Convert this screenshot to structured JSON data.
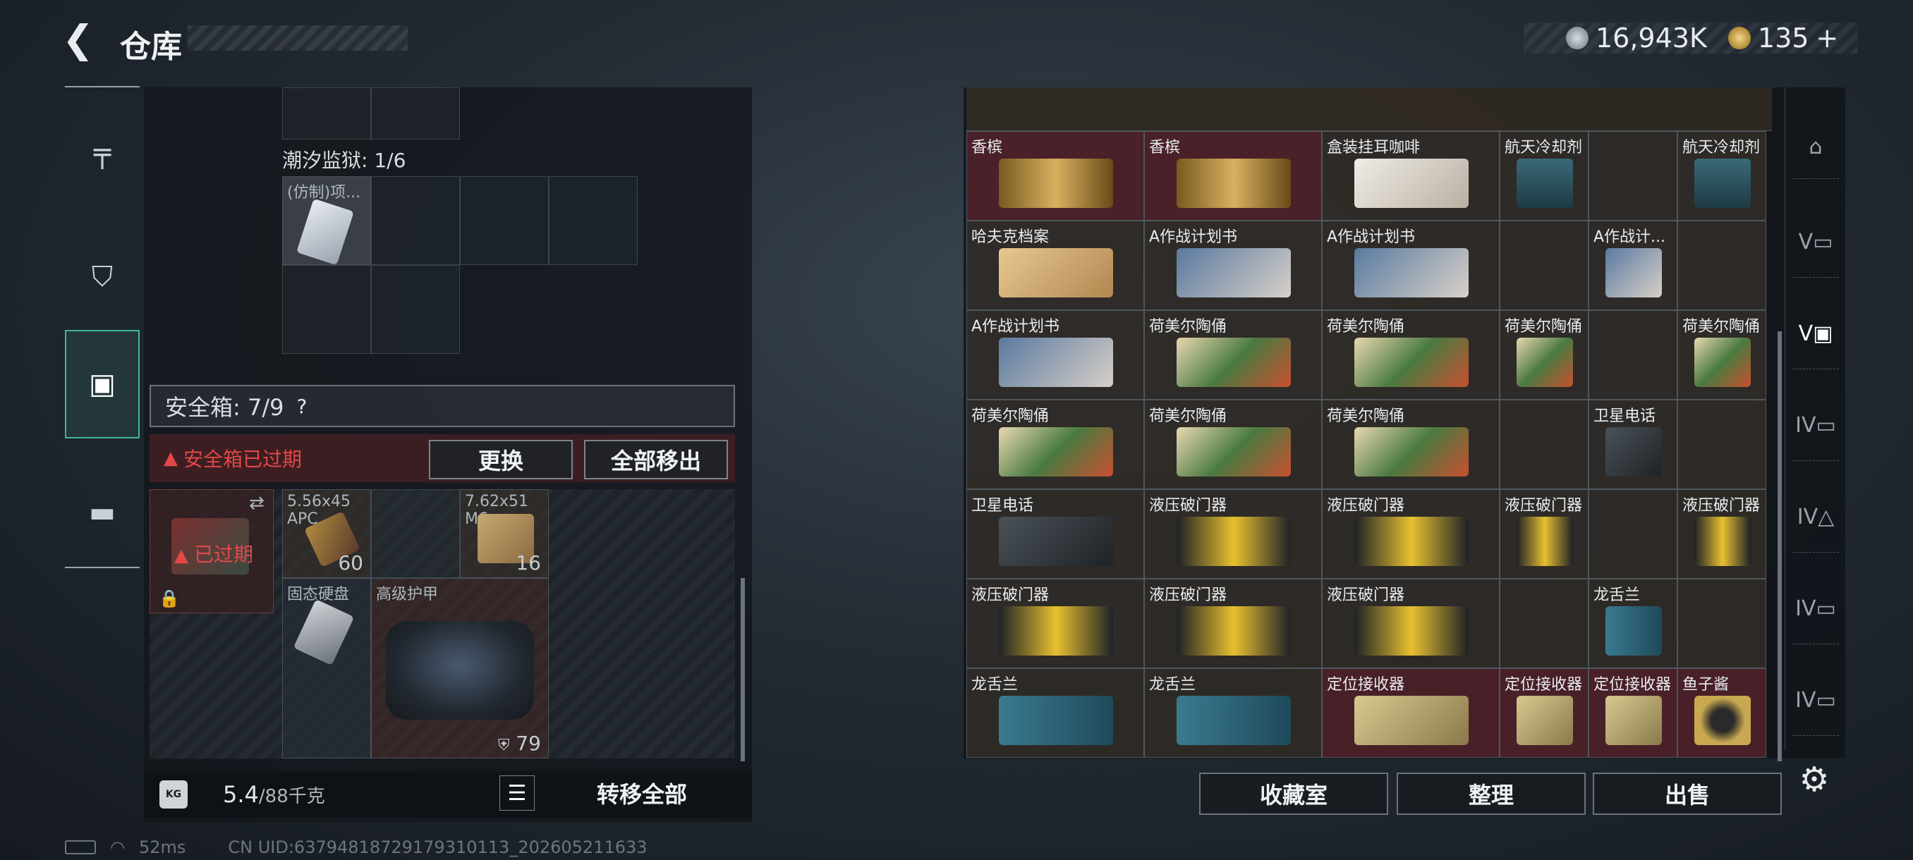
{
  "header": {
    "back_icon": "back-arrow-icon",
    "title": "仓库",
    "currency_1": "16,943K",
    "currency_2": "135",
    "currency_plus": "+"
  },
  "left_nav": [
    {
      "icon": "gun-icon",
      "glyph": "⌐"
    },
    {
      "icon": "backpack-icon",
      "glyph": "⛉"
    },
    {
      "icon": "safebox-icon",
      "glyph": "▣"
    },
    {
      "icon": "briefcase-icon",
      "glyph": "💼"
    }
  ],
  "container": {
    "label": "潮汐监狱: 1/6",
    "item_label": "(仿制)项..."
  },
  "safebox": {
    "title": "安全箱: 7/9",
    "help": "?",
    "expired_message": "安全箱已过期",
    "swap_label": "更换",
    "remove_all_label": "全部移出",
    "thumb_status": "已过期",
    "items": [
      {
        "label": "5.56x45 APC",
        "count": "60"
      },
      {
        "label": "7.62x51 M6",
        "count": "16"
      },
      {
        "label": "固态硬盘",
        "count": ""
      },
      {
        "label": "高级护甲",
        "count": "79"
      }
    ]
  },
  "bottom_left": {
    "weight_icon": "KG",
    "weight": "5.4",
    "weight_max": "/88千克",
    "transfer_all": "转移全部"
  },
  "stash": {
    "rows": [
      [
        {
          "label": "香槟",
          "tone": "red"
        },
        {
          "label": "香槟",
          "tone": "red"
        },
        {
          "label": "盒装挂耳咖啡",
          "tone": "normal"
        },
        {
          "label": "航天冷却剂",
          "tone": "normal"
        },
        {
          "label": "",
          "tone": "normal"
        },
        {
          "label": "航天冷却剂",
          "tone": "normal"
        }
      ],
      [
        {
          "label": "哈夫克档案",
          "tone": "normal"
        },
        {
          "label": "A作战计划书",
          "tone": "normal"
        },
        {
          "label": "A作战计划书",
          "tone": "normal"
        },
        {
          "label": "",
          "tone": "normal"
        },
        {
          "label": "A作战计...",
          "tone": "normal"
        },
        {
          "label": "",
          "tone": "normal"
        }
      ],
      [
        {
          "label": "A作战计划书",
          "tone": "normal"
        },
        {
          "label": "荷美尔陶俑",
          "tone": "normal"
        },
        {
          "label": "荷美尔陶俑",
          "tone": "normal"
        },
        {
          "label": "荷美尔陶俑",
          "tone": "normal"
        },
        {
          "label": "",
          "tone": "normal"
        },
        {
          "label": "荷美尔陶俑",
          "tone": "normal"
        }
      ],
      [
        {
          "label": "荷美尔陶俑",
          "tone": "normal"
        },
        {
          "label": "荷美尔陶俑",
          "tone": "normal"
        },
        {
          "label": "荷美尔陶俑",
          "tone": "normal"
        },
        {
          "label": "",
          "tone": "normal"
        },
        {
          "label": "卫星电话",
          "tone": "normal"
        },
        {
          "label": "",
          "tone": "normal"
        }
      ],
      [
        {
          "label": "卫星电话",
          "tone": "normal"
        },
        {
          "label": "液压破门器",
          "tone": "normal"
        },
        {
          "label": "液压破门器",
          "tone": "normal"
        },
        {
          "label": "液压破门器",
          "tone": "normal"
        },
        {
          "label": "",
          "tone": "normal"
        },
        {
          "label": "液压破门器",
          "tone": "normal"
        }
      ],
      [
        {
          "label": "液压破门器",
          "tone": "normal"
        },
        {
          "label": "液压破门器",
          "tone": "normal"
        },
        {
          "label": "液压破门器",
          "tone": "normal"
        },
        {
          "label": "",
          "tone": "normal"
        },
        {
          "label": "龙舌兰",
          "tone": "normal"
        },
        {
          "label": "",
          "tone": "normal"
        }
      ],
      [
        {
          "label": "龙舌兰",
          "tone": "normal"
        },
        {
          "label": "龙舌兰",
          "tone": "normal"
        },
        {
          "label": "定位接收器",
          "tone": "red"
        },
        {
          "label": "定位接收器",
          "tone": "red"
        },
        {
          "label": "定位接收器",
          "tone": "red"
        },
        {
          "label": "鱼子酱",
          "tone": "red"
        }
      ]
    ]
  },
  "right_tabs": [
    {
      "icon": "dome-icon",
      "glyph": "⌂"
    },
    {
      "icon": "tier-v-box-icon",
      "glyph": "V▭"
    },
    {
      "icon": "tier-v-box-icon-active",
      "glyph": "V▣"
    },
    {
      "icon": "tier-iv-folder-icon",
      "glyph": "IV▭"
    },
    {
      "icon": "tier-iv-warning-icon",
      "glyph": "IV△"
    },
    {
      "icon": "tier-iv-box-icon",
      "glyph": "IV▭"
    },
    {
      "icon": "tier-iv-box-icon-2",
      "glyph": "IV▭"
    }
  ],
  "bottom_right": {
    "collection": "收藏室",
    "organize": "整理",
    "sell": "出售",
    "settings_icon": "gear-icon"
  },
  "status": {
    "ping": "52ms",
    "uid": "CN UID:63794818729179310113_202605211633"
  }
}
